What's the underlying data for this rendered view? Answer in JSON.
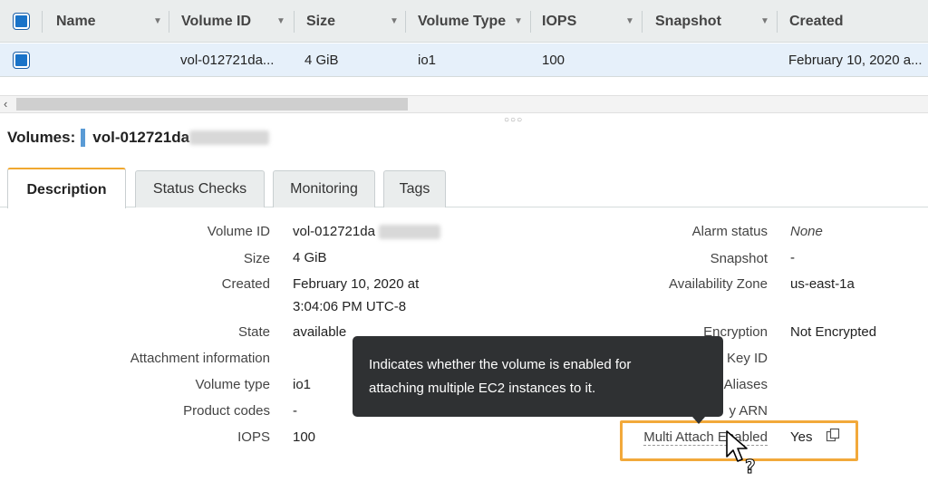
{
  "table": {
    "columns": [
      {
        "label": "Name"
      },
      {
        "label": "Volume ID"
      },
      {
        "label": "Size"
      },
      {
        "label": "Volume Type"
      },
      {
        "label": "IOPS"
      },
      {
        "label": "Snapshot"
      },
      {
        "label": "Created"
      }
    ],
    "row": {
      "name": "",
      "volume_id": "vol-012721da...",
      "size": "4 GiB",
      "volume_type": "io1",
      "iops": "100",
      "snapshot": "",
      "created": "February 10, 2020 a..."
    },
    "scroll_left_glyph": "‹",
    "resize_handle_glyph": "○○○"
  },
  "detail": {
    "title_prefix": "Volumes:",
    "title_volume": "vol-012721da"
  },
  "tabs": [
    {
      "label": "Description",
      "active": true
    },
    {
      "label": "Status Checks",
      "active": false
    },
    {
      "label": "Monitoring",
      "active": false
    },
    {
      "label": "Tags",
      "active": false
    }
  ],
  "left_fields": {
    "volume_id": {
      "label": "Volume ID",
      "value": "vol-012721da"
    },
    "size": {
      "label": "Size",
      "value": "4 GiB"
    },
    "created": {
      "label": "Created",
      "value_line1": "February 10, 2020 at",
      "value_line2": "3:04:06 PM UTC-8"
    },
    "state": {
      "label": "State",
      "value": "available"
    },
    "attachment": {
      "label": "Attachment information",
      "value": ""
    },
    "volume_type": {
      "label": "Volume type",
      "value": "io1"
    },
    "product_codes": {
      "label": "Product codes",
      "value": "-"
    },
    "iops": {
      "label": "IOPS",
      "value": "100"
    }
  },
  "right_fields": {
    "alarm_status": {
      "label": "Alarm status",
      "value": "None"
    },
    "snapshot": {
      "label": "Snapshot",
      "value": "-"
    },
    "availability_zone": {
      "label": "Availability Zone",
      "value": "us-east-1a"
    },
    "encryption": {
      "label": "Encryption",
      "value": "Not Encrypted"
    },
    "kms_key_id": {
      "label": "Key ID",
      "value": ""
    },
    "kms_aliases": {
      "label": "Aliases",
      "value": ""
    },
    "kms_arn": {
      "label": "y ARN",
      "value": ""
    },
    "multi_attach": {
      "label": "Multi Attach Enabled",
      "value": "Yes"
    }
  },
  "tooltip": {
    "line1": "Indicates whether the volume is enabled for",
    "line2": "attaching multiple EC2 instances to it."
  },
  "colors": {
    "accent": "#f2a93b",
    "selected_row": "#e6f0fa",
    "tooltip_bg": "#2f3133"
  },
  "icons": {
    "copy": "copy-icon",
    "cursor": "help-cursor-icon"
  }
}
